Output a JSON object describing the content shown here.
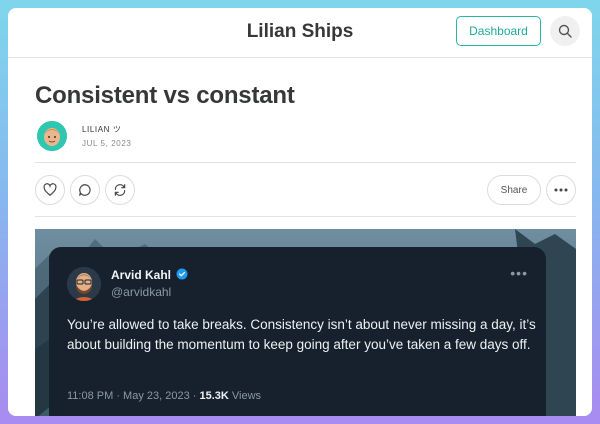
{
  "site": {
    "title": "Lilian Ships",
    "dashboard_label": "Dashboard",
    "search_icon": "search-icon"
  },
  "post": {
    "title": "Consistent vs constant",
    "author": "LILIAN ツ",
    "date": "JUL 5, 2023",
    "actions": {
      "like_icon": "heart-icon",
      "comment_icon": "comment-icon",
      "restack_icon": "restack-icon",
      "share_label": "Share",
      "more_icon": "more-icon"
    }
  },
  "tweet": {
    "name": "Arvid Kahl",
    "verified_icon": "verified-badge-icon",
    "handle": "@arvidkahl",
    "text": "You’re allowed to take breaks. Consistency isn’t about never missing a day, it’s about building the momentum to keep going after you’ve taken a few days off.",
    "time": "11:08 PM · May 23, 2023 · ",
    "views_count": "15.3K",
    "views_label": " Views"
  },
  "colors": {
    "accent": "#1fa99a",
    "tweet_bg": "#16212d",
    "verified": "#1d9bf0"
  }
}
